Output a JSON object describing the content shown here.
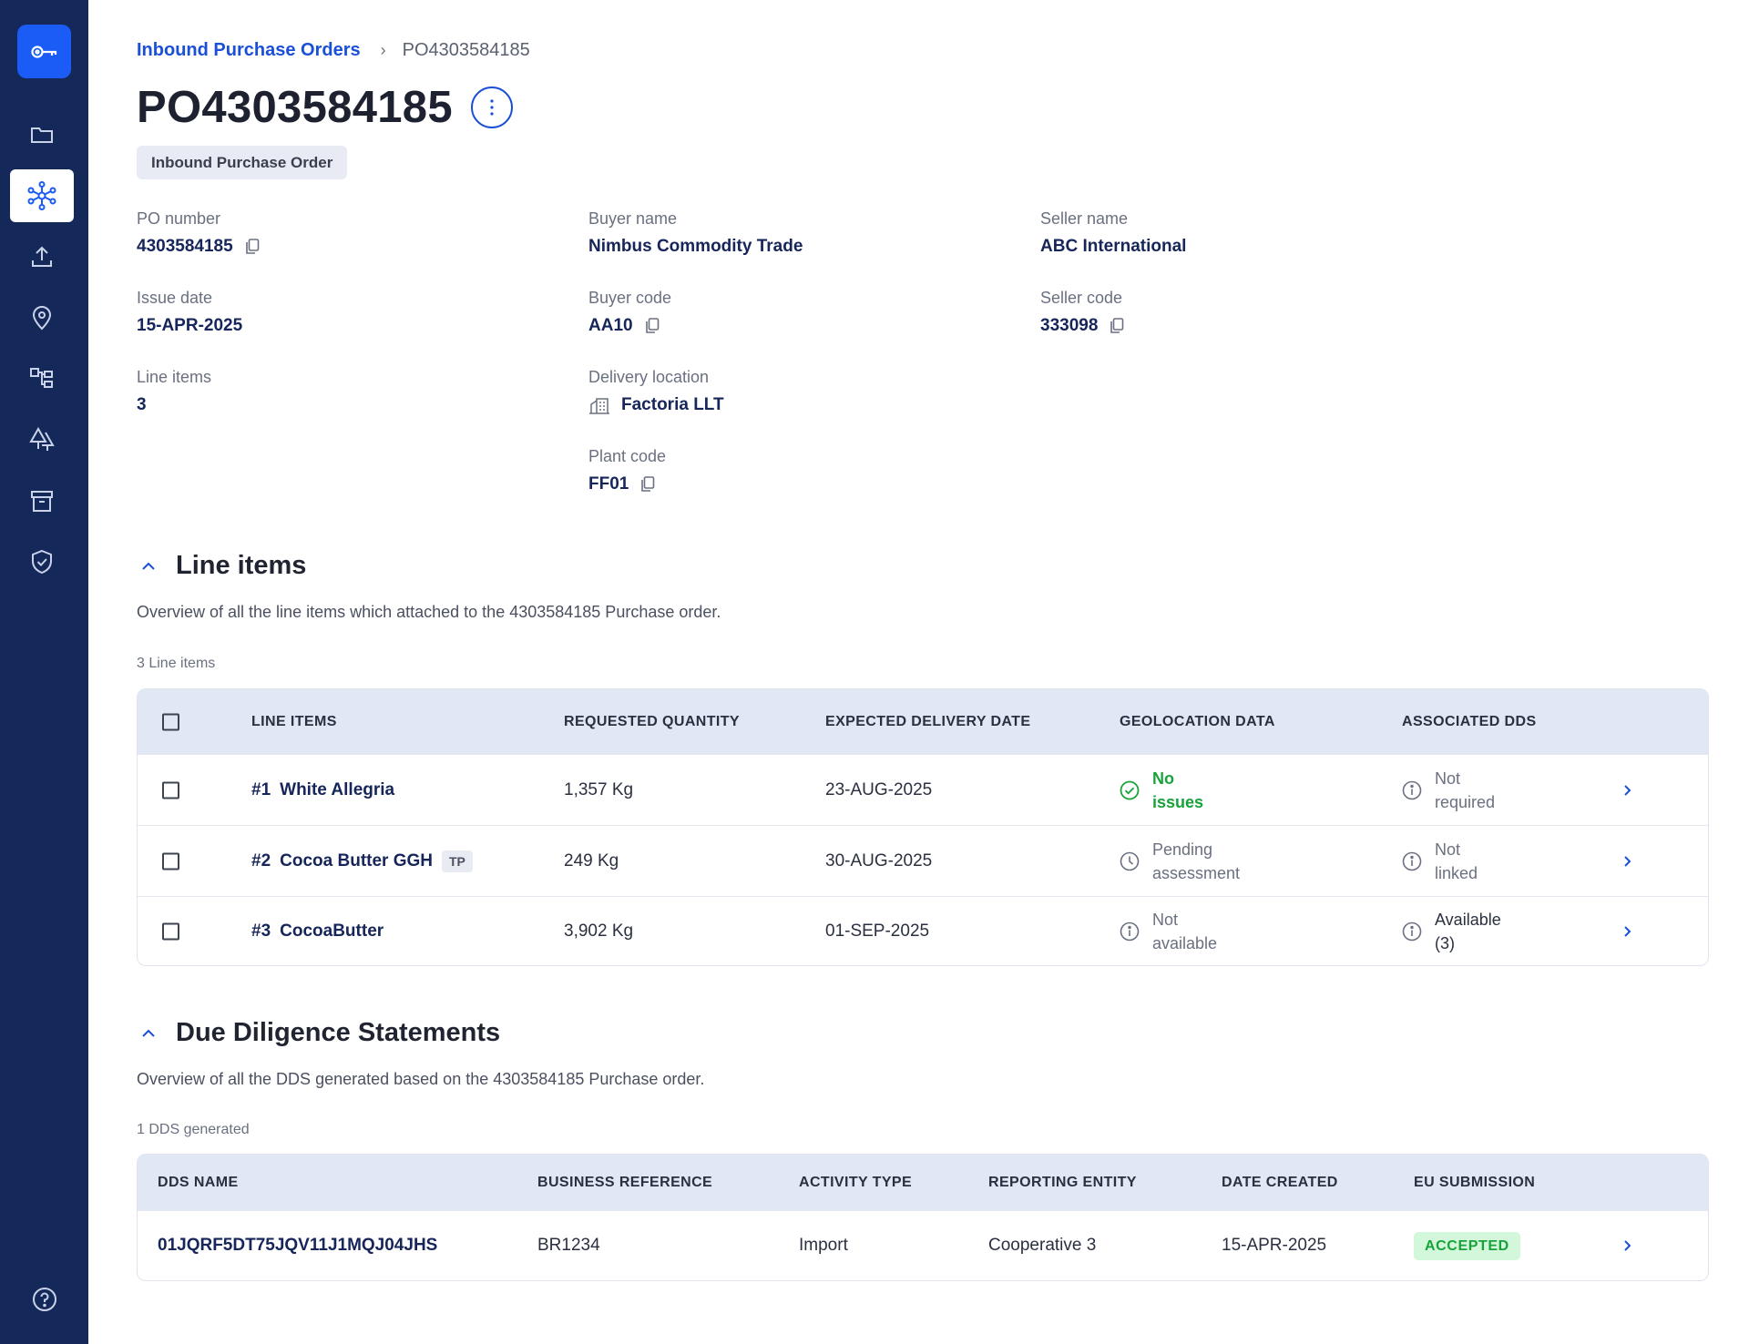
{
  "sidebar": {
    "logo_icon": "key-icon",
    "items": [
      {
        "icon": "folder-icon",
        "active": false
      },
      {
        "icon": "network-icon",
        "active": true
      },
      {
        "icon": "upload-icon",
        "active": false
      },
      {
        "icon": "location-pin-icon",
        "active": false
      },
      {
        "icon": "hierarchy-icon",
        "active": false
      },
      {
        "icon": "trees-icon",
        "active": false
      },
      {
        "icon": "archive-icon",
        "active": false
      },
      {
        "icon": "shield-check-icon",
        "active": false
      }
    ],
    "help_icon": "help-circle-icon"
  },
  "breadcrumb": {
    "parent": "Inbound Purchase Orders",
    "separator": "›",
    "current": "PO4303584185"
  },
  "header": {
    "title": "PO4303584185",
    "type_tag": "Inbound Purchase Order"
  },
  "details": {
    "po_number": {
      "label": "PO number",
      "value": "4303584185"
    },
    "issue_date": {
      "label": "Issue date",
      "value": "15-APR-2025"
    },
    "line_items": {
      "label": "Line items",
      "value": "3"
    },
    "buyer_name": {
      "label": "Buyer name",
      "value": "Nimbus Commodity Trade"
    },
    "buyer_code": {
      "label": "Buyer code",
      "value": "AA10"
    },
    "delivery_location": {
      "label": "Delivery location",
      "value": "Factoria LLT"
    },
    "plant_code": {
      "label": "Plant code",
      "value": "FF01"
    },
    "seller_name": {
      "label": "Seller name",
      "value": "ABC International"
    },
    "seller_code": {
      "label": "Seller code",
      "value": "333098"
    }
  },
  "line_items_section": {
    "title": "Line items",
    "description": "Overview of all the line items which attached to the 4303584185 Purchase order.",
    "count": "3 Line items",
    "columns": [
      "LINE ITEMS",
      "REQUESTED QUANTITY",
      "EXPECTED DELIVERY DATE",
      "GEOLOCATION DATA",
      "ASSOCIATED DDS"
    ],
    "rows": [
      {
        "num": "#1",
        "name": "White Allegria",
        "badge": "",
        "quantity": "1,357 Kg",
        "date": "23-AUG-2025",
        "geo": {
          "l1": "No",
          "l2": "issues",
          "state": "ok"
        },
        "dds": {
          "l1": "Not",
          "l2": "required"
        }
      },
      {
        "num": "#2",
        "name": "Cocoa Butter GGH",
        "badge": "TP",
        "quantity": "249 Kg",
        "date": "30-AUG-2025",
        "geo": {
          "l1": "Pending",
          "l2": "assessment",
          "state": "pending"
        },
        "dds": {
          "l1": "Not",
          "l2": "linked"
        }
      },
      {
        "num": "#3",
        "name": "CocoaButter",
        "badge": "",
        "quantity": "3,902 Kg",
        "date": "01-SEP-2025",
        "geo": {
          "l1": "Not",
          "l2": "available",
          "state": "info"
        },
        "dds": {
          "l1": "Available",
          "l2": "(3)"
        }
      }
    ]
  },
  "dds_section": {
    "title": "Due Diligence Statements",
    "description": "Overview of all the DDS generated based on the 4303584185 Purchase order.",
    "count": "1 DDS generated",
    "columns": [
      "DDS NAME",
      "BUSINESS REFERENCE",
      "ACTIVITY TYPE",
      "REPORTING ENTITY",
      "DATE CREATED",
      "EU SUBMISSION"
    ],
    "rows": [
      {
        "name": "01JQRF5DT75JQV11J1MQJ04JHS",
        "reference": "BR1234",
        "activity": "Import",
        "entity": "Cooperative 3",
        "date": "15-APR-2025",
        "submission": "ACCEPTED"
      }
    ]
  },
  "colors": {
    "sidebar_bg": "#14285a",
    "accent": "#1a5cf5",
    "link": "#1a4fd8",
    "success": "#18a33a",
    "success_bg": "#d3f7da",
    "table_header_bg": "#e1e7f5"
  }
}
